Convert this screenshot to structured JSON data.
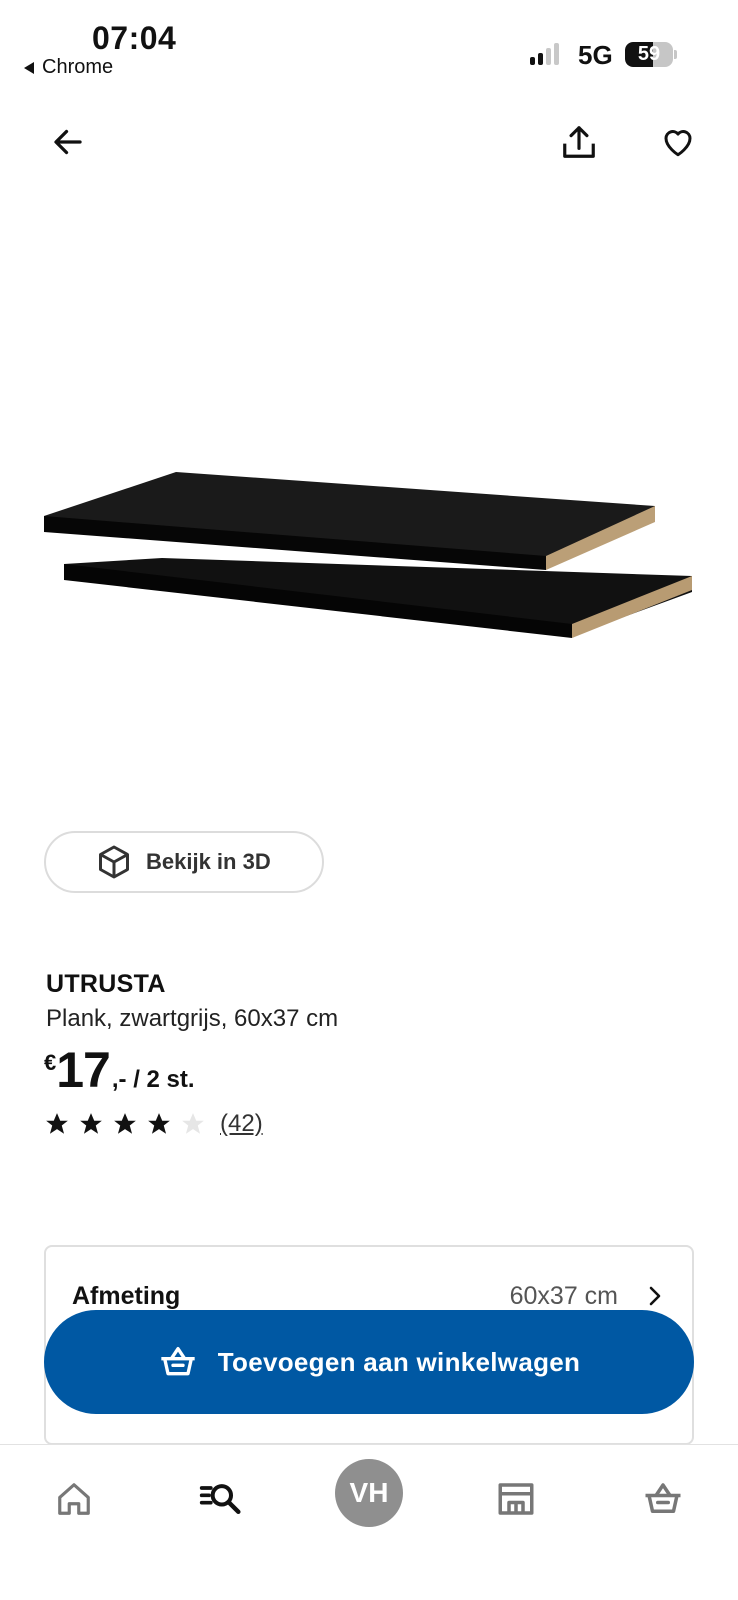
{
  "status_bar": {
    "time": "07:04",
    "back_app": "Chrome",
    "network": "5G",
    "battery": "59",
    "battery_level": 0.59
  },
  "nav": {
    "back_icon": "arrow-left-icon",
    "share_icon": "share-icon",
    "favorite_icon": "heart-icon"
  },
  "product": {
    "image_icon": "shelves-product-image",
    "view_3d_label": "Bekijk in 3D",
    "name": "UTRUSTA",
    "description": "Plank, zwartgrijs, 60x37 cm",
    "price_currency": "€",
    "price_amount": "17",
    "price_suffix": ",- / 2 st.",
    "rating": 4,
    "rating_max": 5,
    "review_count": "(42)"
  },
  "options": [
    {
      "label": "Afmeting",
      "value": "60x37 cm"
    }
  ],
  "cart_button": {
    "label": "Toevoegen aan winkelwagen",
    "color": "#0058a3"
  },
  "bottom_nav": {
    "profile_initials": "VH",
    "items": [
      "home-icon",
      "search-icon",
      "profile-avatar",
      "store-icon",
      "cart-icon"
    ]
  }
}
